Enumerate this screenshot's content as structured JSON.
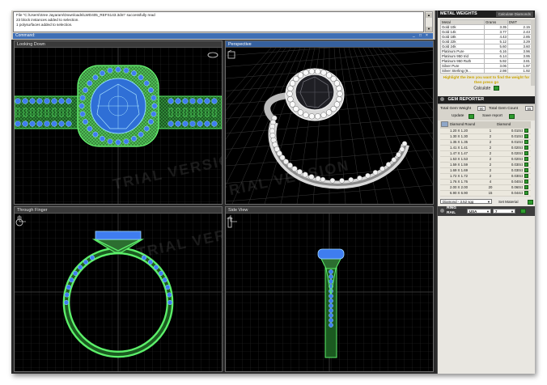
{
  "command": {
    "log": [
      "File \"C:\\Users\\Sree Jayaram\\Downloads\\LWD405_REFS143.3dm\" successfully read",
      "23 block instances added to selection.",
      "1 polysurfaces added to selection."
    ],
    "prompt": "Command:"
  },
  "viewports": {
    "top": {
      "title": "Looking Down"
    },
    "perspective": {
      "title": "Perspective"
    },
    "finger": {
      "title": "Through Finger"
    },
    "side": {
      "title": "Side View"
    }
  },
  "watermark": "TRIAL VERSION",
  "metal_weights": {
    "title": "METAL WEIGHTS",
    "tab": "Calculate Diamonds",
    "columns": [
      "Metal",
      "Grams",
      "DWT"
    ],
    "rows": [
      [
        "Gold 10k",
        "3.35",
        "2.15"
      ],
      [
        "Gold 14k",
        "3.77",
        "2.43"
      ],
      [
        "Gold 18k",
        "4.43",
        "2.85"
      ],
      [
        "Gold 22k",
        "5.12",
        "3.29"
      ],
      [
        "Gold 24k",
        "5.60",
        "3.60"
      ],
      [
        "Platinum Pure",
        "6.16",
        "3.96"
      ],
      [
        "Platinum 950 Irid",
        "6.14",
        "3.95"
      ],
      [
        "Platinum 950 Ruth",
        "5.92",
        "3.81"
      ],
      [
        "Silver Pure",
        "3.06",
        "1.97"
      ],
      [
        "Silver Sterling (9...",
        "2.98",
        "1.92"
      ]
    ],
    "hint": "Highlight the item you want to find the weight for then press go",
    "calculate_label": "Calculate",
    "go_label": "go"
  },
  "gem_reporter": {
    "title": "GEM REPORTER",
    "total_weight_label": "Total Gem Weight",
    "total_weight_value": "90",
    "total_count_label": "Total Gem Count",
    "total_count_value": "55",
    "update_label": "Update",
    "save_report_label": "Save report",
    "columns": [
      "Diamond Round",
      "Diamond"
    ],
    "rows": [
      [
        "1.20 X 1.20",
        "1",
        "0.010ct"
      ],
      [
        "1.30 X 1.30",
        "2",
        "0.010ct"
      ],
      [
        "1.35 X 1.35",
        "2",
        "0.010ct"
      ],
      [
        "1.41 X 1.41",
        "2",
        "0.020ct"
      ],
      [
        "1.47 X 1.47",
        "2",
        "0.020ct"
      ],
      [
        "1.53 X 1.53",
        "2",
        "0.020ct"
      ],
      [
        "1.59 X 1.59",
        "2",
        "0.030ct"
      ],
      [
        "1.69 X 1.69",
        "2",
        "0.030ct"
      ],
      [
        "1.72 X 1.72",
        "2",
        "0.030ct"
      ],
      [
        "1.76 X 1.76",
        "4",
        "0.040ct"
      ],
      [
        "2.00 X 2.00",
        "20",
        "0.060ct"
      ],
      [
        "6.90 X 6.90",
        "15",
        "0.044ct"
      ]
    ],
    "gem_select": "Diamond - 3.52 sgg",
    "set_material_label": "Set Material"
  },
  "ring_rail": {
    "title": "RING RAIL",
    "standard": "USA",
    "size": "7"
  },
  "colors": {
    "wire": "#5cf06a",
    "stone": "#3f7df0",
    "titlebar_active": "#35609e",
    "gold_hint": "#c9a400"
  }
}
